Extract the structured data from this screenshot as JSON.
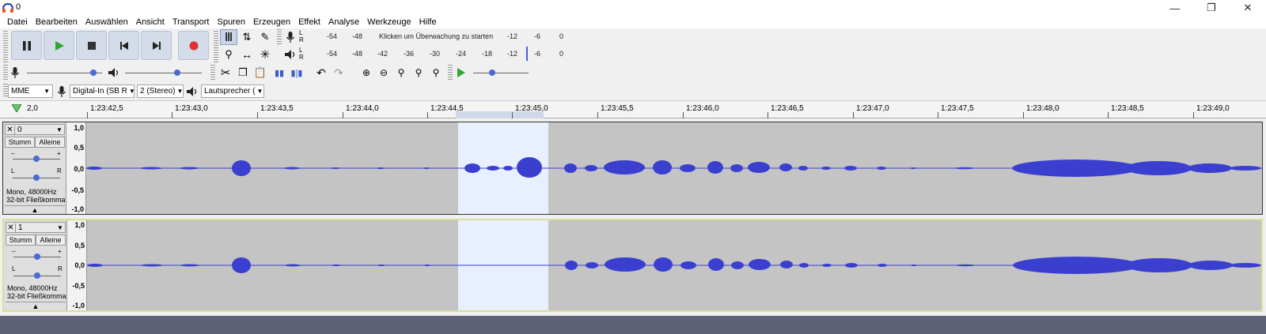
{
  "window": {
    "title": "0",
    "minimize_icon": "minimize-icon",
    "maximize_icon": "restore-icon",
    "close_icon": "close-icon"
  },
  "menu": [
    "Datei",
    "Bearbeiten",
    "Auswählen",
    "Ansicht",
    "Transport",
    "Spuren",
    "Erzeugen",
    "Effekt",
    "Analyse",
    "Werkzeuge",
    "Hilfe"
  ],
  "colors": {
    "accent": "#d4dce9",
    "waveform": "#3a3fd0",
    "track_bg": "#c4c4c4",
    "selection": "#e8f0ff",
    "record": "#e03030",
    "play": "#2fa82f"
  },
  "meters": {
    "record_scale": [
      "-54",
      "-48",
      "Klicken um Überwachung zu starten",
      "-12",
      "-6",
      "0"
    ],
    "play_scale": [
      "-54",
      "-48",
      "-42",
      "-36",
      "-30",
      "-24",
      "-18",
      "-12",
      "-6",
      "0"
    ]
  },
  "device": {
    "host": "MME",
    "input": "Digital-In (SB R",
    "channels": "2 (Stereo)",
    "output": "Lautsprecher ("
  },
  "ruler": {
    "labels": [
      "2,0",
      "1:23:42,5",
      "1:23:43,0",
      "1:23:43,5",
      "1:23:44,0",
      "1:23:44,5",
      "1:23:45,0",
      "1:23:45,5",
      "1:23:46,0",
      "1:23:46,5",
      "1:23:47,0",
      "1:23:47,5",
      "1:23:48,0",
      "1:23:48,5",
      "1:23:49,0"
    ]
  },
  "tracks": [
    {
      "name": "0",
      "mute": "Stumm",
      "solo": "Alleine",
      "info1": "Mono, 48000Hz",
      "info2": "32-bit Fließkomma",
      "scale": [
        "1,0",
        "0,5",
        "0,0",
        "-0,5",
        "-1,0"
      ]
    },
    {
      "name": "1",
      "mute": "Stumm",
      "solo": "Alleine",
      "info1": "Mono, 48000Hz",
      "info2": "32-bit Fließkomma",
      "scale": [
        "1,0",
        "0,5",
        "0,0",
        "-0,5",
        "-1,0"
      ]
    }
  ]
}
